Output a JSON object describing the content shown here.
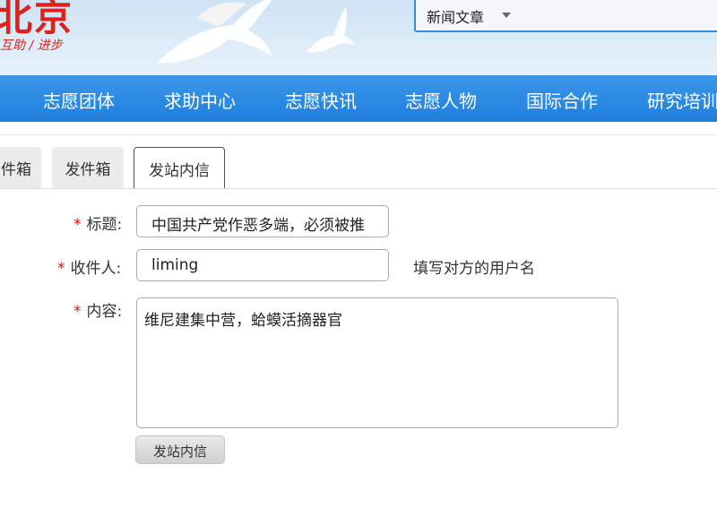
{
  "header": {
    "logo_text": "北京",
    "logo_tagline": "互助 / 进步",
    "search_type": "新闻文章"
  },
  "nav": {
    "items": [
      "志愿团体",
      "求助中心",
      "志愿快讯",
      "志愿人物",
      "国际合作",
      "研究培训"
    ]
  },
  "tabs": [
    "件箱",
    "发件箱",
    "发站内信"
  ],
  "form": {
    "title_label": "标题:",
    "title_value": "中国共产党作恶多端，必须被推",
    "recipient_label": "收件人:",
    "recipient_value": "liming",
    "recipient_hint": "填写对方的用户名",
    "content_label": "内容:",
    "content_value": "维尼建集中营，蛤蟆活摘器官",
    "required_mark": "*",
    "submit_label": "发站内信"
  },
  "colors": {
    "nav_bg": "#2586df",
    "logo_red": "#e0211b",
    "required": "#d11111"
  }
}
